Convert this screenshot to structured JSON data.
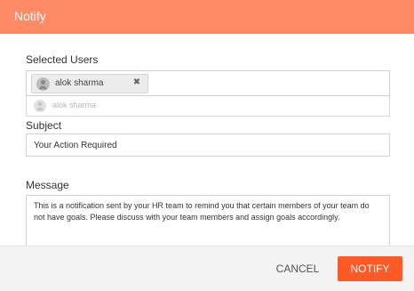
{
  "dialog": {
    "title": "Notify"
  },
  "selected_users": {
    "label": "Selected Users",
    "chips": [
      {
        "name": "alok sharma",
        "avatar_icon": "user-icon",
        "remove_icon": "close-icon",
        "remove_glyph": "✖"
      }
    ],
    "suggestions": [
      {
        "name": "alok sharma",
        "avatar_icon": "user-icon"
      }
    ]
  },
  "subject": {
    "label": "Subject",
    "value": "Your Action Required"
  },
  "message": {
    "label": "Message",
    "value": "This is a notification sent by your HR team to remind you that certain members of your team do not have goals. Please discuss with your team members and assign goals accordingly."
  },
  "actions": {
    "cancel_label": "CANCEL",
    "notify_label": "NOTIFY"
  },
  "colors": {
    "header_accent": "#ff8a66",
    "primary_button": "#ff5a25"
  }
}
